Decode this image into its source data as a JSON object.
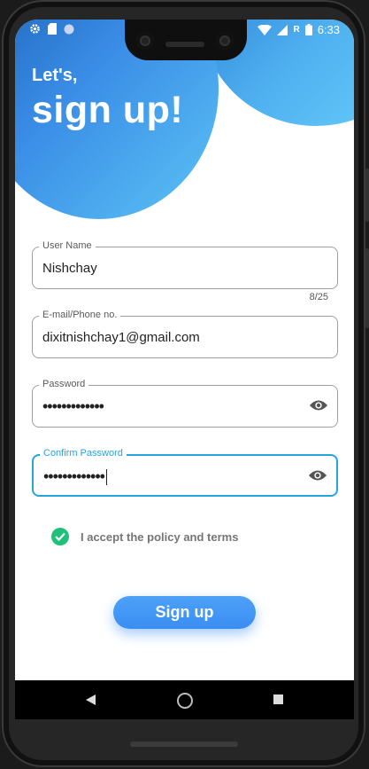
{
  "status_bar": {
    "time": "6:33",
    "network_letter": "R"
  },
  "header": {
    "greeting": "Let's,",
    "title": "sign up!"
  },
  "form": {
    "username": {
      "label": "User Name",
      "value": "Nishchay",
      "counter": "8/25"
    },
    "email": {
      "label": "E-mail/Phone no.",
      "value": "dixitnishchay1@gmail.com"
    },
    "password": {
      "label": "Password",
      "value": "•••••••••••••"
    },
    "confirm_password": {
      "label": "Confirm Password",
      "value": "•••••••••••••"
    }
  },
  "terms": {
    "label": "I accept the policy and terms",
    "checked": true
  },
  "signup_button": {
    "label": "Sign up"
  },
  "colors": {
    "accent": "#27a4e0",
    "button": "#3a8ef4",
    "check": "#1ec07a"
  }
}
